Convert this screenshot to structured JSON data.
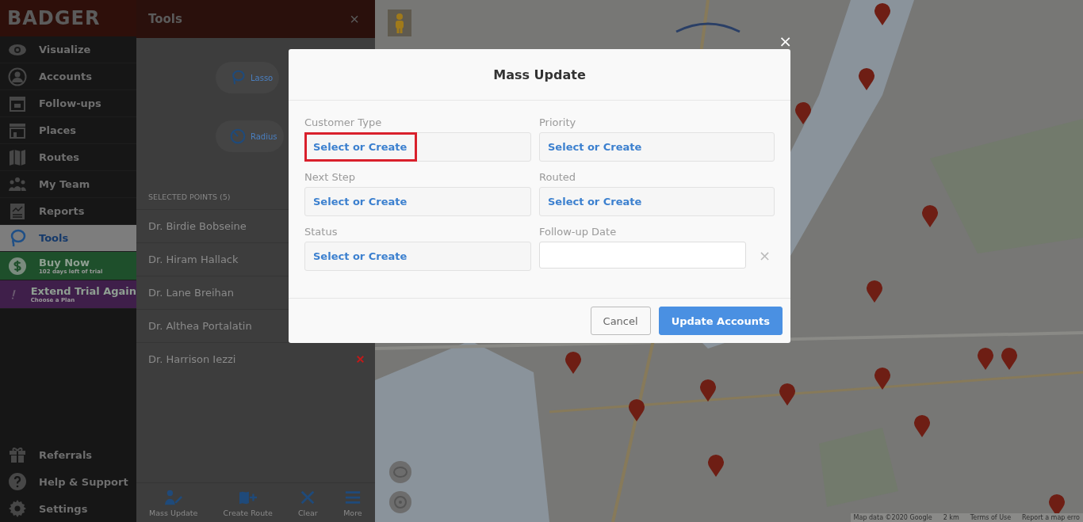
{
  "sidebar": {
    "logo": "BADGER",
    "items": [
      {
        "label": "Visualize",
        "kind": "nav",
        "selected": false
      },
      {
        "label": "Accounts",
        "kind": "nav",
        "selected": false
      },
      {
        "label": "Follow-ups",
        "kind": "nav",
        "selected": false
      },
      {
        "label": "Places",
        "kind": "nav",
        "selected": false
      },
      {
        "label": "Routes",
        "kind": "nav",
        "selected": false
      },
      {
        "label": "My Team",
        "kind": "nav",
        "selected": false
      },
      {
        "label": "Reports",
        "kind": "nav",
        "selected": false
      },
      {
        "label": "Tools",
        "kind": "nav",
        "selected": true
      },
      {
        "label": "Buy Now",
        "subtitle": "102 days left of trial",
        "kind": "promo",
        "color": "#1e4f2b"
      },
      {
        "label": "Extend Trial Again",
        "subtitle": "Choose a Plan",
        "kind": "promo",
        "color": "#3f1f4a"
      }
    ],
    "bottom_items": [
      {
        "label": "Referrals"
      },
      {
        "label": "Help & Support"
      },
      {
        "label": "Settings"
      }
    ]
  },
  "tools_panel": {
    "title": "Tools",
    "close": "×",
    "tools": [
      {
        "label": "Lasso"
      },
      {
        "label": "Radius"
      }
    ],
    "selected_header": "SELECTED POINTS (5)",
    "points": [
      {
        "name": "Dr. Birdie Bobseine",
        "remove_button": false
      },
      {
        "name": "Dr. Hiram Hallack",
        "remove_button": false
      },
      {
        "name": "Dr. Lane Breihan",
        "remove_button": false
      },
      {
        "name": "Dr. Althea Portalatin",
        "remove_button": false
      },
      {
        "name": "Dr. Harrison Iezzi",
        "remove_button": true
      }
    ],
    "actions": [
      {
        "label": "Mass Update"
      },
      {
        "label": "Create Route"
      },
      {
        "label": "Clear"
      },
      {
        "label": "More"
      }
    ]
  },
  "map": {
    "kind": "picture",
    "footer": [
      "Map data ©2020 Google",
      "2 km",
      "Terms of Use",
      "Report a map erro"
    ]
  },
  "modal": {
    "title": "Mass Update",
    "close": "×",
    "fields": [
      {
        "label": "Customer Type",
        "kind": "select",
        "value": "Select or Create",
        "highlighted": true
      },
      {
        "label": "Priority",
        "kind": "select",
        "value": "Select or Create",
        "highlighted": false
      },
      {
        "label": "Next Step",
        "kind": "select",
        "value": "Select or Create",
        "highlighted": false
      },
      {
        "label": "Routed",
        "kind": "select",
        "value": "Select or Create",
        "highlighted": false
      },
      {
        "label": "Status",
        "kind": "select",
        "value": "Select or Create",
        "highlighted": false
      },
      {
        "label": "Follow-up Date",
        "kind": "date",
        "clear": "×",
        "highlighted": false
      }
    ],
    "buttons": [
      {
        "label": "Cancel",
        "kind": "secondary"
      },
      {
        "label": "Update Accounts",
        "kind": "primary"
      }
    ]
  }
}
